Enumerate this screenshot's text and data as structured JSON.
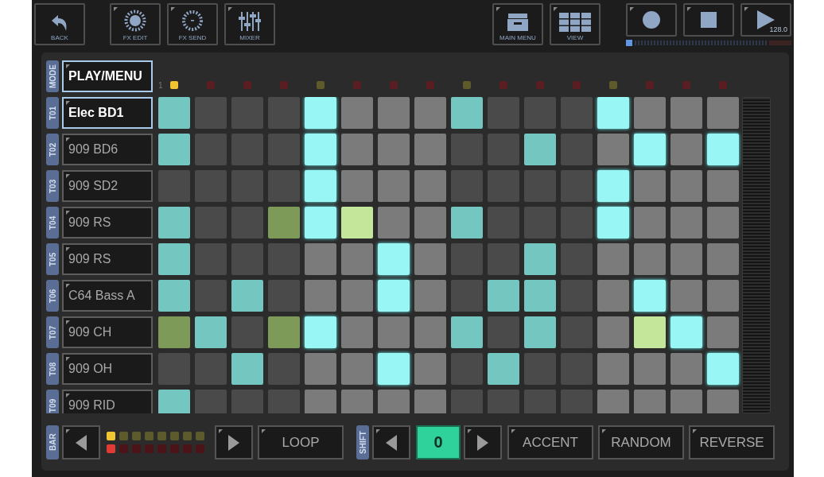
{
  "toolbar": {
    "left": [
      {
        "kind": "back",
        "label": "BACK"
      },
      {
        "kind": "fx-edit",
        "label": "FX EDIT"
      },
      {
        "kind": "fx-send",
        "label": "FX SEND"
      },
      {
        "kind": "mixer",
        "label": "MIXER"
      }
    ],
    "right": [
      {
        "kind": "main-menu",
        "label": "MAIN MENU"
      },
      {
        "kind": "view",
        "label": "VIEW"
      }
    ]
  },
  "transport": [
    {
      "kind": "record"
    },
    {
      "kind": "stop"
    },
    {
      "kind": "play",
      "tempo": "128.0"
    }
  ],
  "mode": {
    "label": "MODE",
    "value": "PLAY/MENU"
  },
  "step_markers": [
    {
      "label": "1",
      "kind": "current"
    },
    {
      "kind": "off"
    },
    {
      "kind": "off"
    },
    {
      "kind": "off"
    },
    {
      "kind": "beat"
    },
    {
      "kind": "off"
    },
    {
      "kind": "off"
    },
    {
      "kind": "off"
    },
    {
      "kind": "beat"
    },
    {
      "kind": "off"
    },
    {
      "kind": "off"
    },
    {
      "kind": "off"
    },
    {
      "kind": "beat"
    },
    {
      "kind": "off"
    },
    {
      "kind": "off"
    },
    {
      "kind": "off"
    }
  ],
  "tracks": [
    {
      "id": "T01",
      "name": "Elec BD1",
      "selected": true,
      "steps": [
        {
          "kind": "soft"
        },
        {
          "kind": "off"
        },
        {
          "kind": "off"
        },
        {
          "kind": "off"
        },
        {
          "kind": "loud"
        },
        {
          "kind": "off"
        },
        {
          "kind": "off"
        },
        {
          "kind": "off"
        },
        {
          "kind": "soft"
        },
        {
          "kind": "off"
        },
        {
          "kind": "off"
        },
        {
          "kind": "off"
        },
        {
          "kind": "loud"
        },
        {
          "kind": "off"
        },
        {
          "kind": "off"
        },
        {
          "kind": "off"
        }
      ]
    },
    {
      "id": "T02",
      "name": "909 BD6",
      "selected": false,
      "steps": [
        {
          "kind": "soft"
        },
        {
          "kind": "off"
        },
        {
          "kind": "off"
        },
        {
          "kind": "off"
        },
        {
          "kind": "loud"
        },
        {
          "kind": "off"
        },
        {
          "kind": "off"
        },
        {
          "kind": "off"
        },
        {
          "kind": "off"
        },
        {
          "kind": "off"
        },
        {
          "kind": "soft"
        },
        {
          "kind": "off"
        },
        {
          "kind": "off"
        },
        {
          "kind": "loud"
        },
        {
          "kind": "off"
        },
        {
          "kind": "loud"
        }
      ]
    },
    {
      "id": "T03",
      "name": "909 SD2",
      "selected": false,
      "steps": [
        {
          "kind": "off"
        },
        {
          "kind": "off"
        },
        {
          "kind": "off"
        },
        {
          "kind": "off"
        },
        {
          "kind": "loud"
        },
        {
          "kind": "off"
        },
        {
          "kind": "off"
        },
        {
          "kind": "off"
        },
        {
          "kind": "off"
        },
        {
          "kind": "off"
        },
        {
          "kind": "off"
        },
        {
          "kind": "off"
        },
        {
          "kind": "loud"
        },
        {
          "kind": "off"
        },
        {
          "kind": "off"
        },
        {
          "kind": "off"
        }
      ]
    },
    {
      "id": "T04",
      "name": "909 RS",
      "selected": false,
      "steps": [
        {
          "kind": "soft"
        },
        {
          "kind": "off"
        },
        {
          "kind": "off"
        },
        {
          "kind": "accent"
        },
        {
          "kind": "loud"
        },
        {
          "kind": "strong"
        },
        {
          "kind": "off"
        },
        {
          "kind": "off"
        },
        {
          "kind": "soft"
        },
        {
          "kind": "off"
        },
        {
          "kind": "off"
        },
        {
          "kind": "off"
        },
        {
          "kind": "loud"
        },
        {
          "kind": "off"
        },
        {
          "kind": "off"
        },
        {
          "kind": "off"
        }
      ]
    },
    {
      "id": "T05",
      "name": "909 RS",
      "selected": false,
      "steps": [
        {
          "kind": "soft"
        },
        {
          "kind": "off"
        },
        {
          "kind": "off"
        },
        {
          "kind": "off"
        },
        {
          "kind": "off"
        },
        {
          "kind": "off"
        },
        {
          "kind": "loud"
        },
        {
          "kind": "off"
        },
        {
          "kind": "off"
        },
        {
          "kind": "off"
        },
        {
          "kind": "soft"
        },
        {
          "kind": "off"
        },
        {
          "kind": "off"
        },
        {
          "kind": "off"
        },
        {
          "kind": "off"
        },
        {
          "kind": "off"
        }
      ]
    },
    {
      "id": "T06",
      "name": "C64 Bass A",
      "selected": false,
      "steps": [
        {
          "kind": "soft"
        },
        {
          "kind": "off"
        },
        {
          "kind": "soft"
        },
        {
          "kind": "off"
        },
        {
          "kind": "off"
        },
        {
          "kind": "off"
        },
        {
          "kind": "loud"
        },
        {
          "kind": "off"
        },
        {
          "kind": "off"
        },
        {
          "kind": "soft"
        },
        {
          "kind": "soft"
        },
        {
          "kind": "off"
        },
        {
          "kind": "off"
        },
        {
          "kind": "loud"
        },
        {
          "kind": "off"
        },
        {
          "kind": "off"
        }
      ]
    },
    {
      "id": "T07",
      "name": "909 CH",
      "selected": false,
      "steps": [
        {
          "kind": "accent"
        },
        {
          "kind": "soft"
        },
        {
          "kind": "off"
        },
        {
          "kind": "accent"
        },
        {
          "kind": "loud"
        },
        {
          "kind": "off"
        },
        {
          "kind": "off"
        },
        {
          "kind": "off"
        },
        {
          "kind": "soft"
        },
        {
          "kind": "off"
        },
        {
          "kind": "soft"
        },
        {
          "kind": "off"
        },
        {
          "kind": "off"
        },
        {
          "kind": "strong"
        },
        {
          "kind": "loud"
        },
        {
          "kind": "off"
        }
      ]
    },
    {
      "id": "T08",
      "name": "909 OH",
      "selected": false,
      "steps": [
        {
          "kind": "off"
        },
        {
          "kind": "off"
        },
        {
          "kind": "soft"
        },
        {
          "kind": "off"
        },
        {
          "kind": "off"
        },
        {
          "kind": "off"
        },
        {
          "kind": "loud"
        },
        {
          "kind": "off"
        },
        {
          "kind": "off"
        },
        {
          "kind": "soft"
        },
        {
          "kind": "off"
        },
        {
          "kind": "off"
        },
        {
          "kind": "off"
        },
        {
          "kind": "off"
        },
        {
          "kind": "off"
        },
        {
          "kind": "loud"
        }
      ]
    },
    {
      "id": "T09",
      "name": "909 RID",
      "selected": false,
      "steps": [
        {
          "kind": "soft"
        },
        {
          "kind": "off"
        },
        {
          "kind": "off"
        },
        {
          "kind": "off"
        },
        {
          "kind": "off"
        },
        {
          "kind": "off"
        },
        {
          "kind": "off"
        },
        {
          "kind": "off"
        },
        {
          "kind": "off"
        },
        {
          "kind": "off"
        },
        {
          "kind": "off"
        },
        {
          "kind": "off"
        },
        {
          "kind": "off"
        },
        {
          "kind": "off"
        },
        {
          "kind": "off"
        },
        {
          "kind": "off"
        }
      ]
    }
  ],
  "bar": {
    "label": "BAR",
    "upper_leds": [
      {
        "lit": true
      },
      {
        "lit": false
      },
      {
        "lit": false
      },
      {
        "lit": false
      },
      {
        "lit": false
      },
      {
        "lit": false
      },
      {
        "lit": false
      },
      {
        "lit": false
      }
    ],
    "lower_leds": [
      {
        "lit": true
      },
      {
        "lit": false
      },
      {
        "lit": false
      },
      {
        "lit": false
      },
      {
        "lit": false
      },
      {
        "lit": false
      },
      {
        "lit": false
      },
      {
        "lit": false
      }
    ],
    "loop": "LOOP"
  },
  "shift": {
    "label": "SHIFT",
    "value": "0"
  },
  "buttons": [
    "ACCENT",
    "RANDOM",
    "REVERSE"
  ]
}
